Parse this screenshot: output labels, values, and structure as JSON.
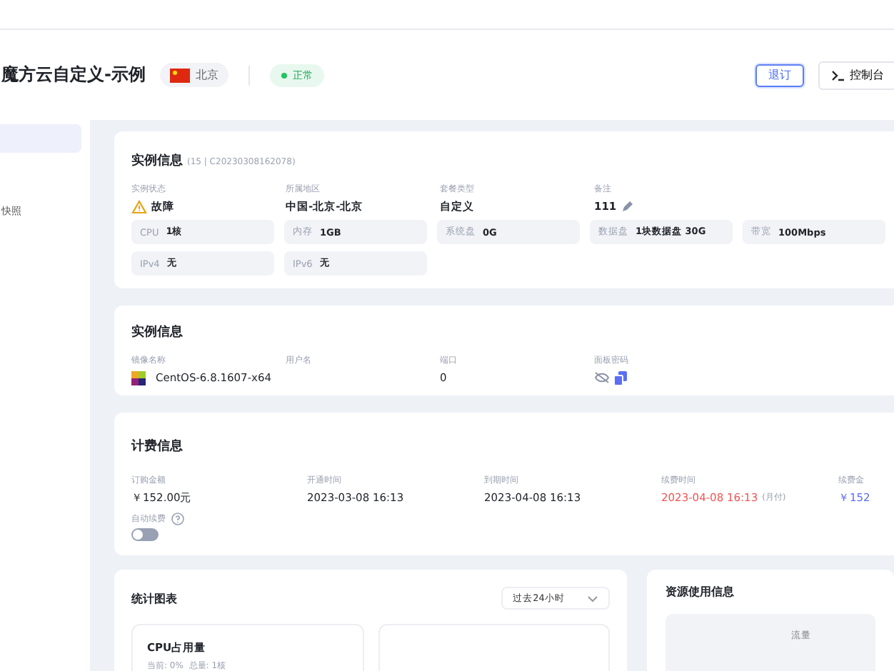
{
  "header": {
    "title": "魔方云自定义-示例",
    "region": {
      "label": "北京"
    },
    "status": {
      "label": "正常",
      "color": "#22c55e"
    },
    "buttons": [
      {
        "label": "退订",
        "kind": "outline"
      },
      {
        "label": "控制台",
        "kind": "console"
      }
    ]
  },
  "sidebar": {
    "items": [
      {
        "selected": true
      },
      {
        "label": "快照",
        "selected": false
      }
    ]
  },
  "instance": {
    "title": "实例信息",
    "subtitle": "(15 | C20230308162078)",
    "fields": [
      {
        "label": "实例状态",
        "value": "故障",
        "kind": "warning"
      },
      {
        "label": "所属地区",
        "value": "中国-北京-北京",
        "kind": "text"
      },
      {
        "label": "套餐类型",
        "value": "自定义",
        "kind": "text"
      },
      {
        "label": "备注",
        "value": "111",
        "kind": "edit"
      }
    ],
    "specs": [
      {
        "label": "CPU",
        "value": "1核"
      },
      {
        "label": "内存",
        "value": "1GB"
      },
      {
        "label": "系统盘",
        "value": "0G"
      },
      {
        "label": "数据盘",
        "value": "1块数据盘 30G"
      },
      {
        "label": "带宽",
        "value": "100Mbps"
      },
      {
        "label": "IPv4",
        "value": "无"
      },
      {
        "label": "IPv6",
        "value": "无"
      }
    ]
  },
  "access": {
    "title": "实例信息",
    "fields": [
      {
        "label": "镜像名称",
        "value": "CentOS-6.8.1607-x64",
        "kind": "os"
      },
      {
        "label": "用户名",
        "kind": "text"
      },
      {
        "label": "端口",
        "value": "0",
        "kind": "text"
      },
      {
        "label": "面板密码",
        "kind": "password"
      }
    ]
  },
  "billing": {
    "title": "计费信息",
    "fields": [
      {
        "label": "订购金额",
        "value": "￥152.00元",
        "kind": "text"
      },
      {
        "label": "开通时间",
        "value": "2023-03-08 16:13",
        "kind": "text"
      },
      {
        "label": "到期时间",
        "value": "2023-04-08 16:13",
        "kind": "text"
      },
      {
        "label": "续费时间",
        "value": "2023-04-08 16:13",
        "note": "(月付)",
        "kind": "danger"
      },
      {
        "label": "续费金",
        "value": "￥152",
        "kind": "price"
      }
    ],
    "auto_renew": {
      "label": "自动续费",
      "on": false
    }
  },
  "stats": {
    "title": "统计图表",
    "range": "过去24小时",
    "cards": [
      {
        "title": "CPU占用量",
        "detail": "当前: 0%  总量: 1核"
      }
    ]
  },
  "resources": {
    "title": "资源使用信息",
    "label": "流量"
  }
}
